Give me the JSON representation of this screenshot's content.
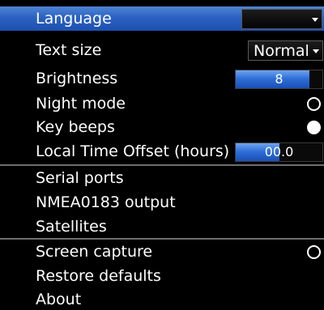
{
  "menu": {
    "language": {
      "label": "Language",
      "value": ""
    },
    "text_size": {
      "label": "Text size",
      "value": "Normal"
    },
    "brightness": {
      "label": "Brightness",
      "value": "8",
      "level_fraction": 0.85
    },
    "night_mode": {
      "label": "Night mode",
      "state": "off"
    },
    "key_beeps": {
      "label": "Key beeps",
      "state": "on"
    },
    "time_offset": {
      "label": "Local Time Offset (hours)",
      "value": "00.0",
      "level_fraction": 0.5
    },
    "serial_ports": {
      "label": "Serial ports"
    },
    "nmea_output": {
      "label": "NMEA0183 output"
    },
    "satellites": {
      "label": "Satellites"
    },
    "screen_capture": {
      "label": "Screen capture",
      "state": "off"
    },
    "restore_defaults": {
      "label": "Restore defaults"
    },
    "about": {
      "label": "About"
    }
  },
  "colors": {
    "background": "#000000",
    "selection": "#2b62c2",
    "slider_fill": "#2f6fd8",
    "text": "#ffffff",
    "divider": "#6e6e6e"
  },
  "selected_item": "language"
}
